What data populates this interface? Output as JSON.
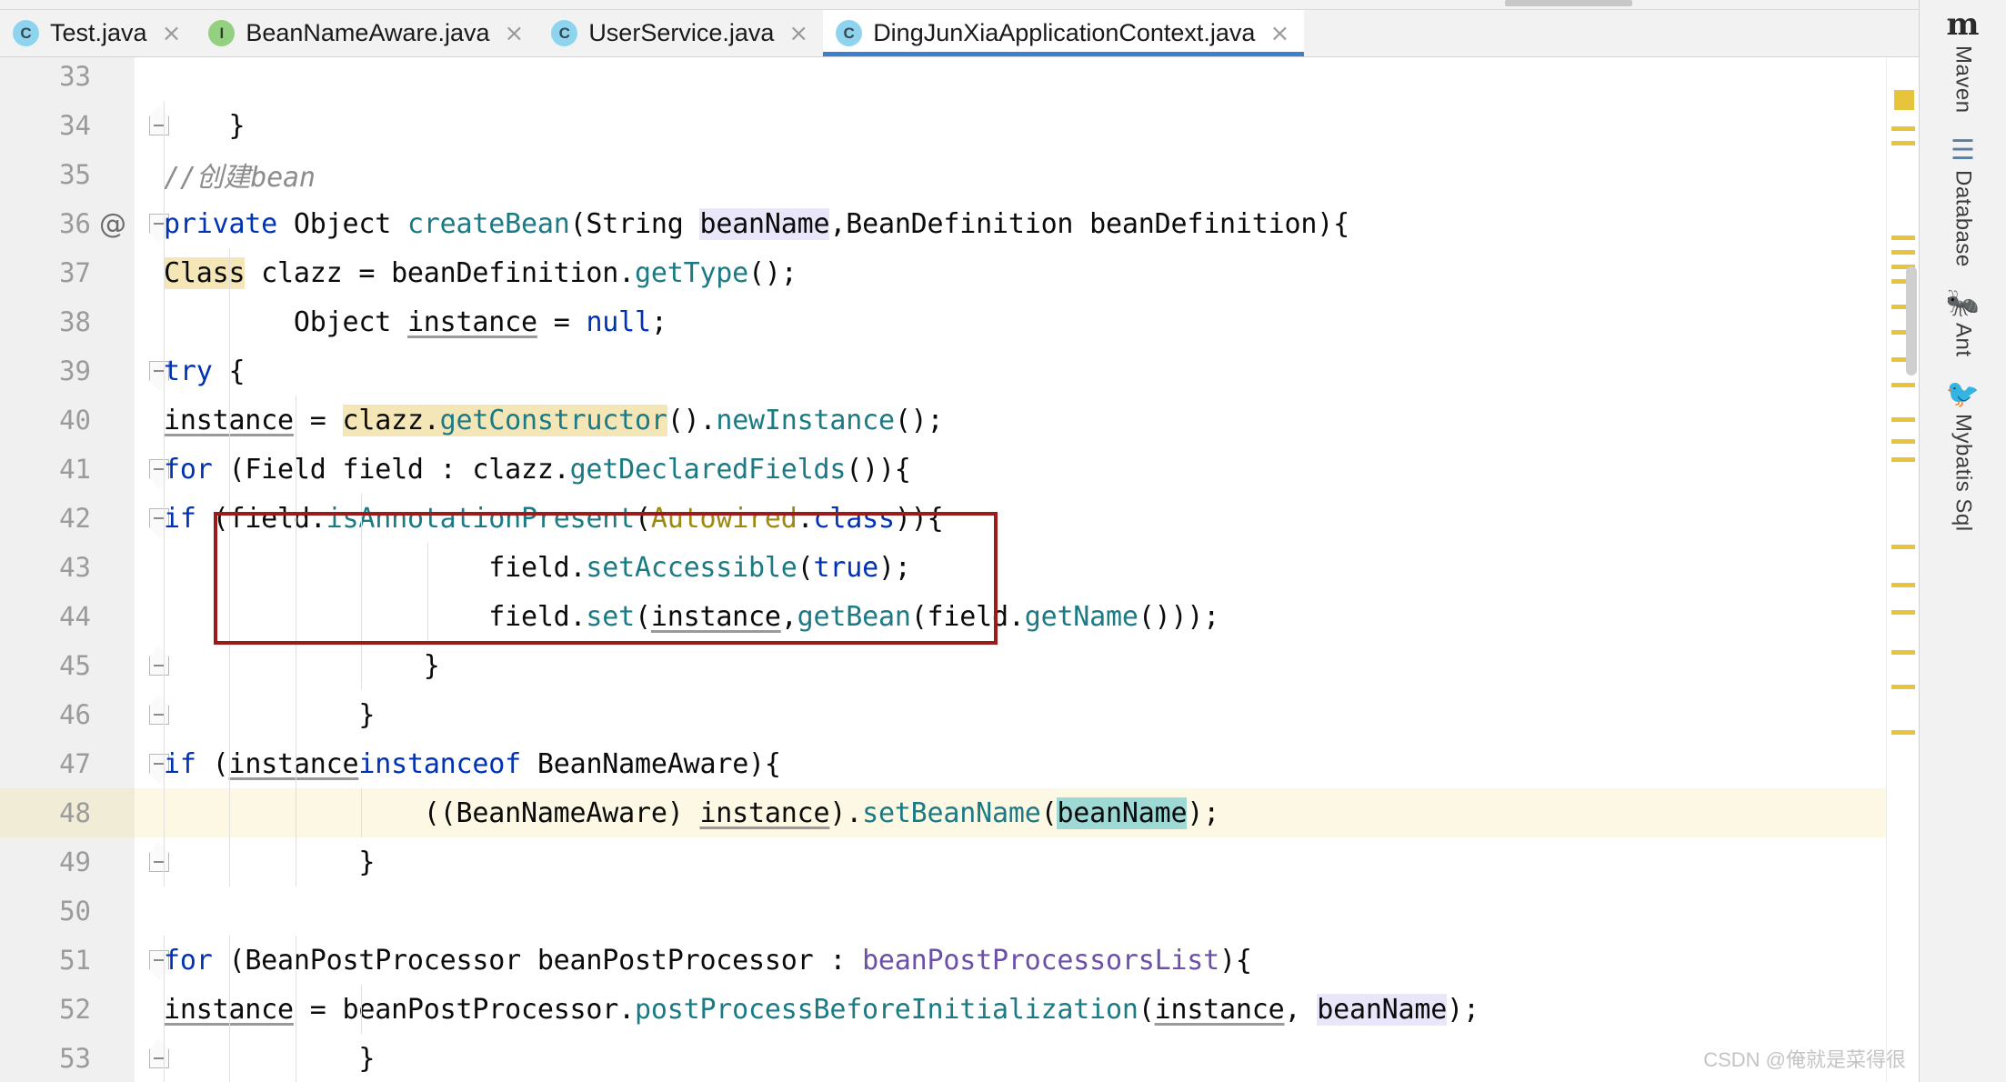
{
  "window": {
    "app": "IntelliJ IDEA",
    "watermark": "CSDN @俺就是菜得很"
  },
  "tabs": [
    {
      "label": "Test.java",
      "icon": "java-class-runnable-icon",
      "icon_letter": "C",
      "kind": "class",
      "runnable": true,
      "active": false,
      "close": "×"
    },
    {
      "label": "BeanNameAware.java",
      "icon": "java-interface-icon",
      "icon_letter": "I",
      "kind": "interface",
      "runnable": false,
      "active": false,
      "close": "×"
    },
    {
      "label": "UserService.java",
      "icon": "java-class-icon",
      "icon_letter": "C",
      "kind": "class",
      "runnable": false,
      "active": false,
      "close": "×"
    },
    {
      "label": "DingJunXiaApplicationContext.java",
      "icon": "java-class-icon",
      "icon_letter": "C",
      "kind": "class",
      "runnable": false,
      "active": true,
      "close": "×"
    }
  ],
  "right_toolbar": [
    {
      "label": "Maven",
      "icon": "maven-icon",
      "glyph": "m"
    },
    {
      "label": "Database",
      "icon": "database-icon",
      "glyph": "☰"
    },
    {
      "label": "Ant",
      "icon": "ant-icon",
      "glyph": "🐜"
    },
    {
      "label": "Mybatis Sql",
      "icon": "mybatis-icon",
      "glyph": "🐦"
    }
  ],
  "editor": {
    "accent_color": "#3d7fcc",
    "annotation_box_color": "#9b1b1b",
    "search_highlight_color": "#f5e6b8",
    "selection_highlight_color": "#9ed9d5",
    "identifier_highlight_color": "#e9e6f9",
    "current_line_color": "#fdf8e4",
    "current_line": 48,
    "first_visible_line": 33,
    "lines": [
      {
        "n": "33",
        "text": "",
        "fold": "none",
        "annot": ""
      },
      {
        "n": "34",
        "text": "    }",
        "fold": "up",
        "annot": ""
      },
      {
        "n": "35",
        "text": "    //创建bean",
        "fold": "none",
        "annot": ""
      },
      {
        "n": "36",
        "text": "    private Object createBean(String beanName,BeanDefinition beanDefinition){",
        "fold": "down",
        "annot": "@"
      },
      {
        "n": "37",
        "text": "        Class clazz = beanDefinition.getType();",
        "fold": "none",
        "annot": ""
      },
      {
        "n": "38",
        "text": "        Object instance = null;",
        "fold": "none",
        "annot": ""
      },
      {
        "n": "39",
        "text": "        try {",
        "fold": "down",
        "annot": ""
      },
      {
        "n": "40",
        "text": "            instance = clazz.getConstructor().newInstance();",
        "fold": "none",
        "annot": ""
      },
      {
        "n": "41",
        "text": "            for (Field field : clazz.getDeclaredFields()){",
        "fold": "down",
        "annot": ""
      },
      {
        "n": "42",
        "text": "                if (field.isAnnotationPresent(Autowired.class)){",
        "fold": "down",
        "annot": ""
      },
      {
        "n": "43",
        "text": "                    field.setAccessible(true);",
        "fold": "none",
        "annot": ""
      },
      {
        "n": "44",
        "text": "                    field.set(instance,getBean(field.getName()));",
        "fold": "none",
        "annot": ""
      },
      {
        "n": "45",
        "text": "                }",
        "fold": "up",
        "annot": ""
      },
      {
        "n": "46",
        "text": "            }",
        "fold": "up",
        "annot": ""
      },
      {
        "n": "47",
        "text": "            if (instance instanceof BeanNameAware){",
        "fold": "down",
        "annot": ""
      },
      {
        "n": "48",
        "text": "                ((BeanNameAware) instance).setBeanName(beanName);",
        "fold": "none",
        "annot": ""
      },
      {
        "n": "49",
        "text": "            }",
        "fold": "up",
        "annot": ""
      },
      {
        "n": "50",
        "text": "",
        "fold": "none",
        "annot": ""
      },
      {
        "n": "51",
        "text": "            for (BeanPostProcessor beanPostProcessor : beanPostProcessorsList){",
        "fold": "down",
        "annot": ""
      },
      {
        "n": "52",
        "text": "                instance = beanPostProcessor.postProcessBeforeInitialization(instance, beanName);",
        "fold": "none",
        "annot": ""
      },
      {
        "n": "53",
        "text": "            }",
        "fold": "up",
        "annot": ""
      }
    ]
  }
}
